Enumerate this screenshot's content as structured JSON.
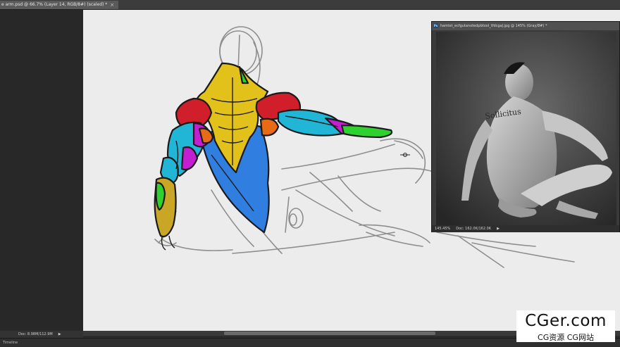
{
  "document_tab": {
    "title": "e arm.psd @ 66.7% (Layer 14, RGB/8#) (scaled) *",
    "close_glyph": "×"
  },
  "status_bar": {
    "doc_label": "Doc: 8.98M/112.9M",
    "arrow_glyph": "▶"
  },
  "timeline": {
    "label": "Timeline"
  },
  "reference_window": {
    "title": "hamlet_ecfgutanotedpbtool_tfdcgaJ.jpg @ 145% (Gray/8#) *",
    "app_icon_text": "Ps",
    "zoom": "145.45%",
    "doc_size": "Doc: 162.0K/162.0K",
    "arrow_glyph": "▶",
    "tattoo_text": "Sollicitus"
  },
  "watermark": {
    "main": "CGer.com",
    "sub": "CG资源 CG网站"
  },
  "colors": {
    "canvas": "#ececec",
    "muscle_red": "#d01e2a",
    "muscle_yellow": "#e2c21a",
    "muscle_blue": "#2f7ee0",
    "muscle_cyan": "#22b6d6",
    "muscle_magenta": "#c21fd0",
    "muscle_green": "#2ed12e",
    "muscle_orange": "#e86a14"
  }
}
